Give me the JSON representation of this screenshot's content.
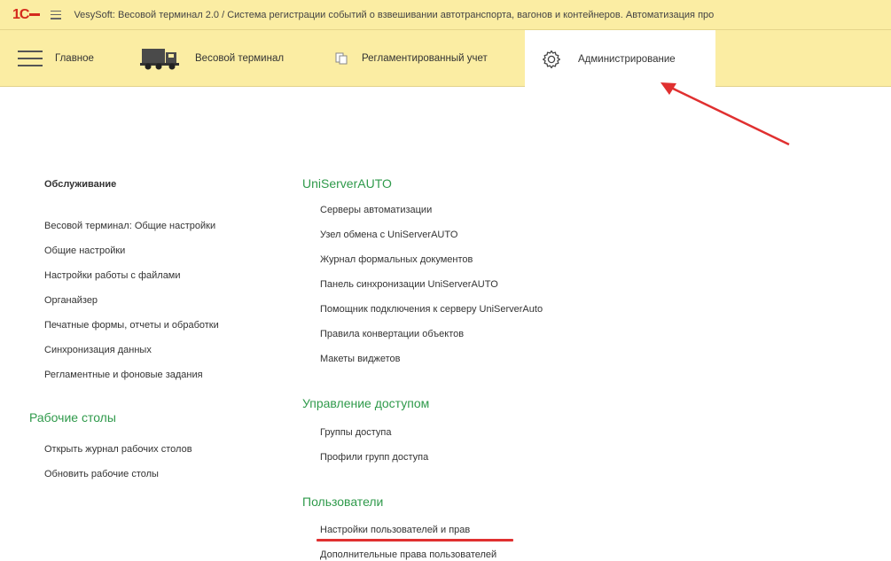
{
  "titlebar": {
    "logo": "1С",
    "title": "VesySoft: Весовой терминал 2.0 / Система регистрации событий о взвешивании автотранспорта, вагонов и контейнеров. Автоматизация про"
  },
  "sections": {
    "main": "Главное",
    "weight_terminal": "Весовой терминал",
    "regulated": "Регламентированный учет",
    "admin": "Администрирование"
  },
  "left": {
    "service_title": "Обслуживание",
    "service_items": [
      "Весовой терминал: Общие настройки",
      "Общие настройки",
      "Настройки работы с файлами",
      "Органайзер",
      "Печатные формы, отчеты и обработки",
      "Синхронизация данных",
      "Регламентные и фоновые задания"
    ],
    "desktops_title": "Рабочие столы",
    "desktops_items": [
      "Открыть журнал рабочих столов",
      "Обновить рабочие столы"
    ]
  },
  "right": {
    "uniserver_title": "UniServerAUTO",
    "uniserver_items": [
      "Серверы автоматизации",
      "Узел обмена с UniServerAUTO",
      "Журнал формальных документов",
      "Панель синхронизации UniServerAUTO",
      "Помощник подключения к серверу UniServerAuto",
      "Правила конвертации объектов",
      "Макеты виджетов"
    ],
    "access_title": "Управление доступом",
    "access_items": [
      "Группы доступа",
      "Профили групп доступа"
    ],
    "users_title": "Пользователи",
    "users_items": [
      "Настройки пользователей и прав",
      "Дополнительные права пользователей"
    ]
  },
  "colors": {
    "header_bg": "#fbeda3",
    "group_title": "#2f9a4b",
    "annotation": "#e03030",
    "brand": "#d42a1c"
  }
}
